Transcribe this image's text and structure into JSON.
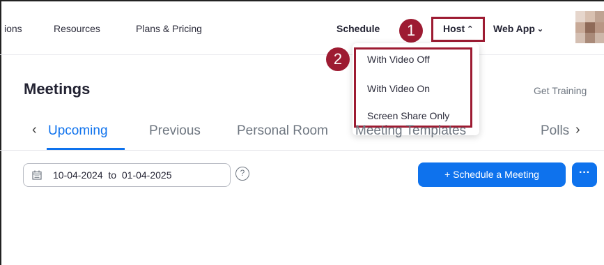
{
  "nav": {
    "partial_label": "ions",
    "resources": "Resources",
    "plans": "Plans & Pricing",
    "schedule": "Schedule",
    "host": "Host",
    "web_app": "Web App"
  },
  "markers": {
    "one": "1",
    "two": "2"
  },
  "host_menu": {
    "items": [
      "With Video Off",
      "With Video On",
      "Screen Share Only"
    ]
  },
  "page": {
    "title": "Meetings",
    "get_training": "Get Training",
    "tabs": [
      "Upcoming",
      "Previous",
      "Personal Room",
      "Meeting Templates",
      "Polls"
    ],
    "active_tab": "Upcoming"
  },
  "date_range": {
    "from": "10-04-2024",
    "to_label": "to",
    "to": "01-04-2025"
  },
  "buttons": {
    "schedule_meeting": "+ Schedule a Meeting",
    "more": "···"
  },
  "colors": {
    "accent": "#0e72ed",
    "annotation": "#9d1b32"
  },
  "icons": [
    "calendar-icon",
    "help-icon",
    "chevron-up-icon",
    "chevron-down-icon",
    "chevron-left-icon",
    "chevron-right-icon"
  ]
}
